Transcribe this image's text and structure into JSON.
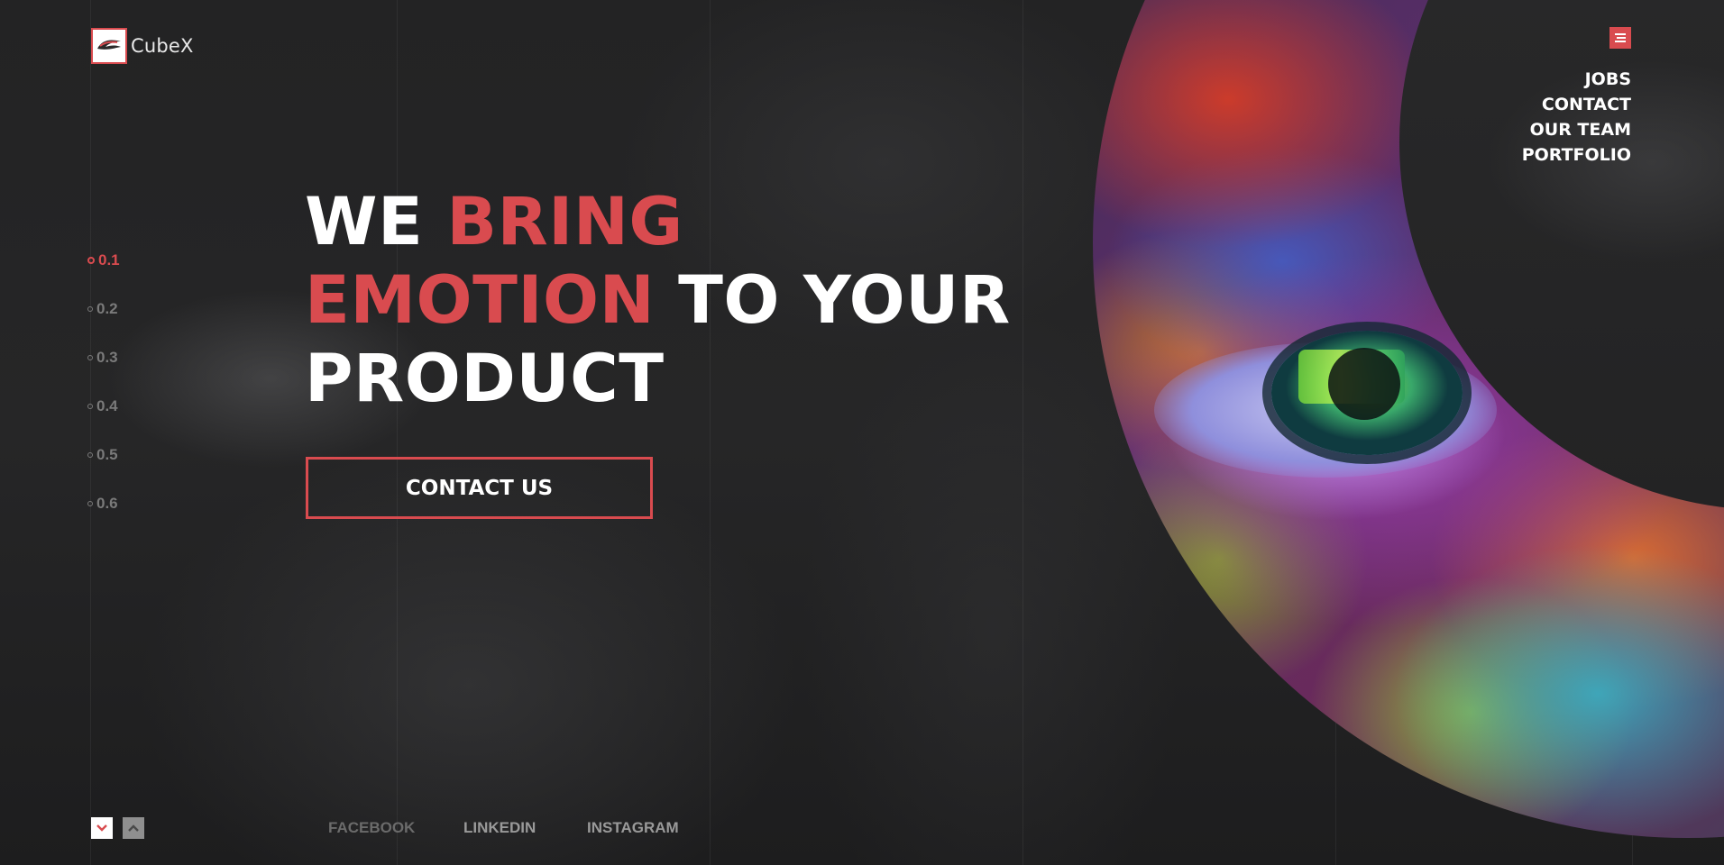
{
  "brand": {
    "logo_text": "CubeX",
    "accent_color": "#d94b4f"
  },
  "menu": {
    "icon": "hamburger-menu-icon",
    "items": [
      "JOBS",
      "CONTACT",
      "OUR TEAM",
      "PORTFOLIO"
    ]
  },
  "pager": {
    "items": [
      "0.1",
      "0.2",
      "0.3",
      "0.4",
      "0.5",
      "0.6"
    ],
    "active_index": 0
  },
  "hero": {
    "line1_a": "WE ",
    "line1_b": "BRING",
    "line2_a": "EMOTION",
    "line2_b": " TO YOUR",
    "line3": "PRODUCT",
    "cta_label": "CONTACT US"
  },
  "controls": {
    "down_icon": "chevron-down-icon",
    "up_icon": "chevron-up-icon"
  },
  "socials": [
    "FACEBOOK",
    "LINKEDIN",
    "INSTAGRAM"
  ]
}
